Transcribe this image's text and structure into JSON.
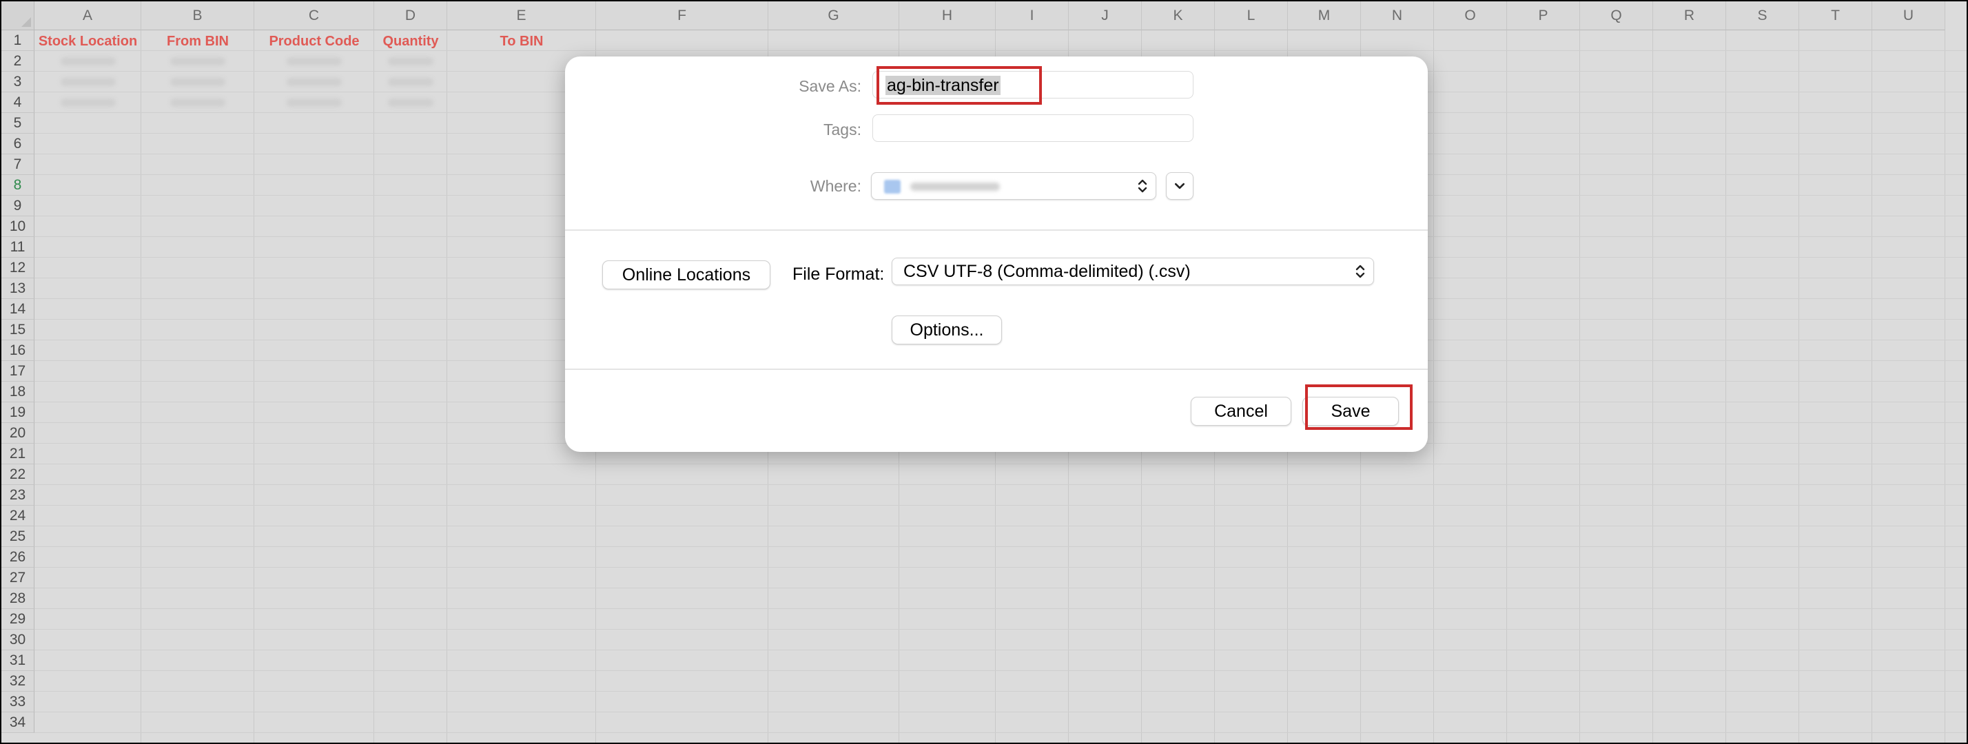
{
  "spreadsheet": {
    "columns": [
      "A",
      "B",
      "C",
      "D",
      "E",
      "F",
      "G",
      "H",
      "I",
      "J",
      "K",
      "L",
      "M",
      "N",
      "O",
      "P",
      "Q",
      "R",
      "S",
      "T",
      "U"
    ],
    "rows": [
      "1",
      "2",
      "3",
      "4",
      "5",
      "6",
      "7",
      "8",
      "9",
      "10",
      "11",
      "12",
      "13",
      "14",
      "15",
      "16",
      "17",
      "18",
      "19",
      "20",
      "21",
      "22",
      "23",
      "24",
      "25",
      "26",
      "27",
      "28",
      "29",
      "30",
      "31",
      "32",
      "33",
      "34"
    ],
    "selected_row": "8",
    "header_row": [
      "Stock Location",
      "From BIN",
      "Product Code",
      "Quantity",
      "To BIN"
    ],
    "header_color": "#e05a55"
  },
  "dialog": {
    "save_as_label": "Save As:",
    "save_as_value": "ag-bin-transfer",
    "tags_label": "Tags:",
    "tags_value": "",
    "where_label": "Where:",
    "online_locations_label": "Online Locations",
    "file_format_label": "File Format:",
    "file_format_value": "CSV UTF-8 (Comma-delimited) (.csv)",
    "options_label": "Options...",
    "cancel_label": "Cancel",
    "save_label": "Save",
    "highlight_color": "#cc2b2b"
  }
}
